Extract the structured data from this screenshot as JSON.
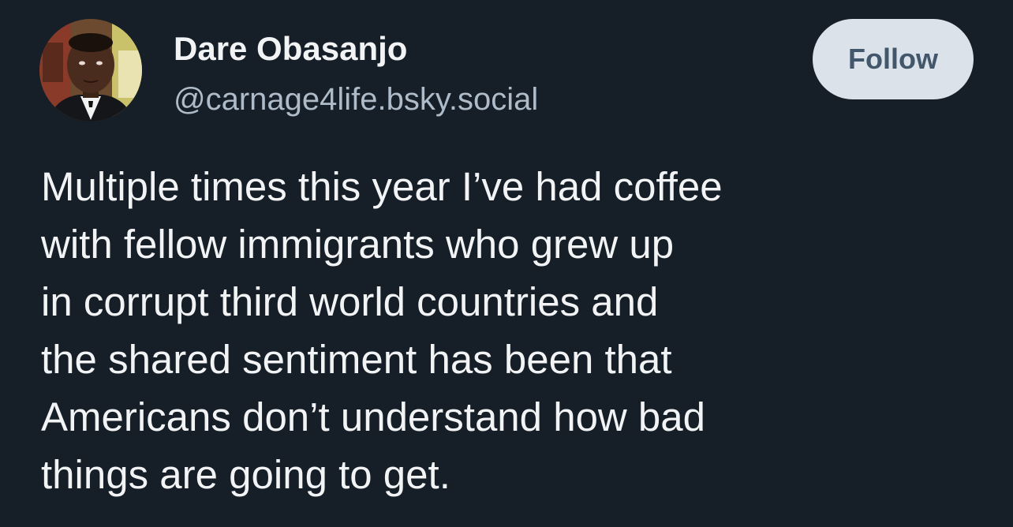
{
  "author": {
    "display_name": "Dare Obasanjo",
    "handle": "@carnage4life.bsky.social",
    "avatar_icon": "user-avatar"
  },
  "follow_button": {
    "label": "Follow"
  },
  "post": {
    "lines": [
      "Multiple times this year I’ve had coffee",
      "with fellow immigrants who grew up",
      "in corrupt third world countries and",
      "the shared sentiment has been that",
      "Americans don’t understand how bad",
      "things are going to get."
    ]
  },
  "colors": {
    "background": "#161e27",
    "text_primary": "#f1f3f5",
    "text_secondary": "#aebbc9",
    "button_bg": "#dce2ea",
    "button_text": "#42576c"
  }
}
